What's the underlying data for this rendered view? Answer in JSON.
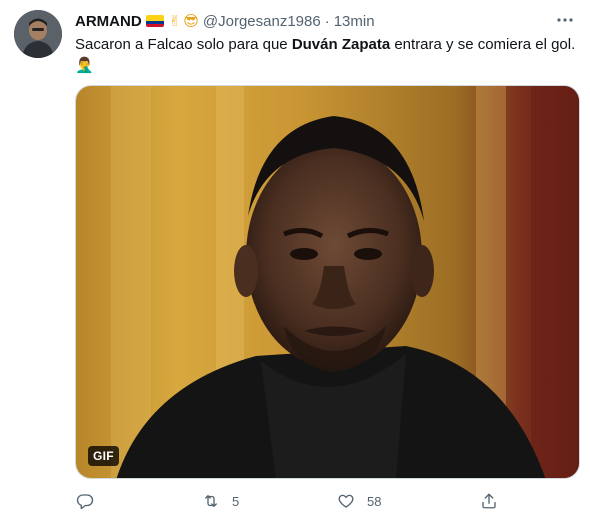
{
  "tweet": {
    "author_name": "ARMAND",
    "author_emojis": {
      "flag": "colombia-flag",
      "hand": "✌",
      "face": "😎"
    },
    "handle": "@Jorgesanz1986",
    "separator": "·",
    "time": "13min",
    "text": {
      "before": "Sacaron a Falcao solo para que ",
      "bold": "Duván Zapata",
      "after": " entrara y se comiera el gol.",
      "trailing_emoji": "🤦‍♂️"
    },
    "media": {
      "type": "gif",
      "badge": "GIF"
    },
    "actions": {
      "reply_count": "",
      "retweet_count": "5",
      "like_count": "58"
    }
  },
  "colors": {
    "text_primary": "#0f1419",
    "text_secondary": "#536471",
    "border": "#cfd9de"
  }
}
